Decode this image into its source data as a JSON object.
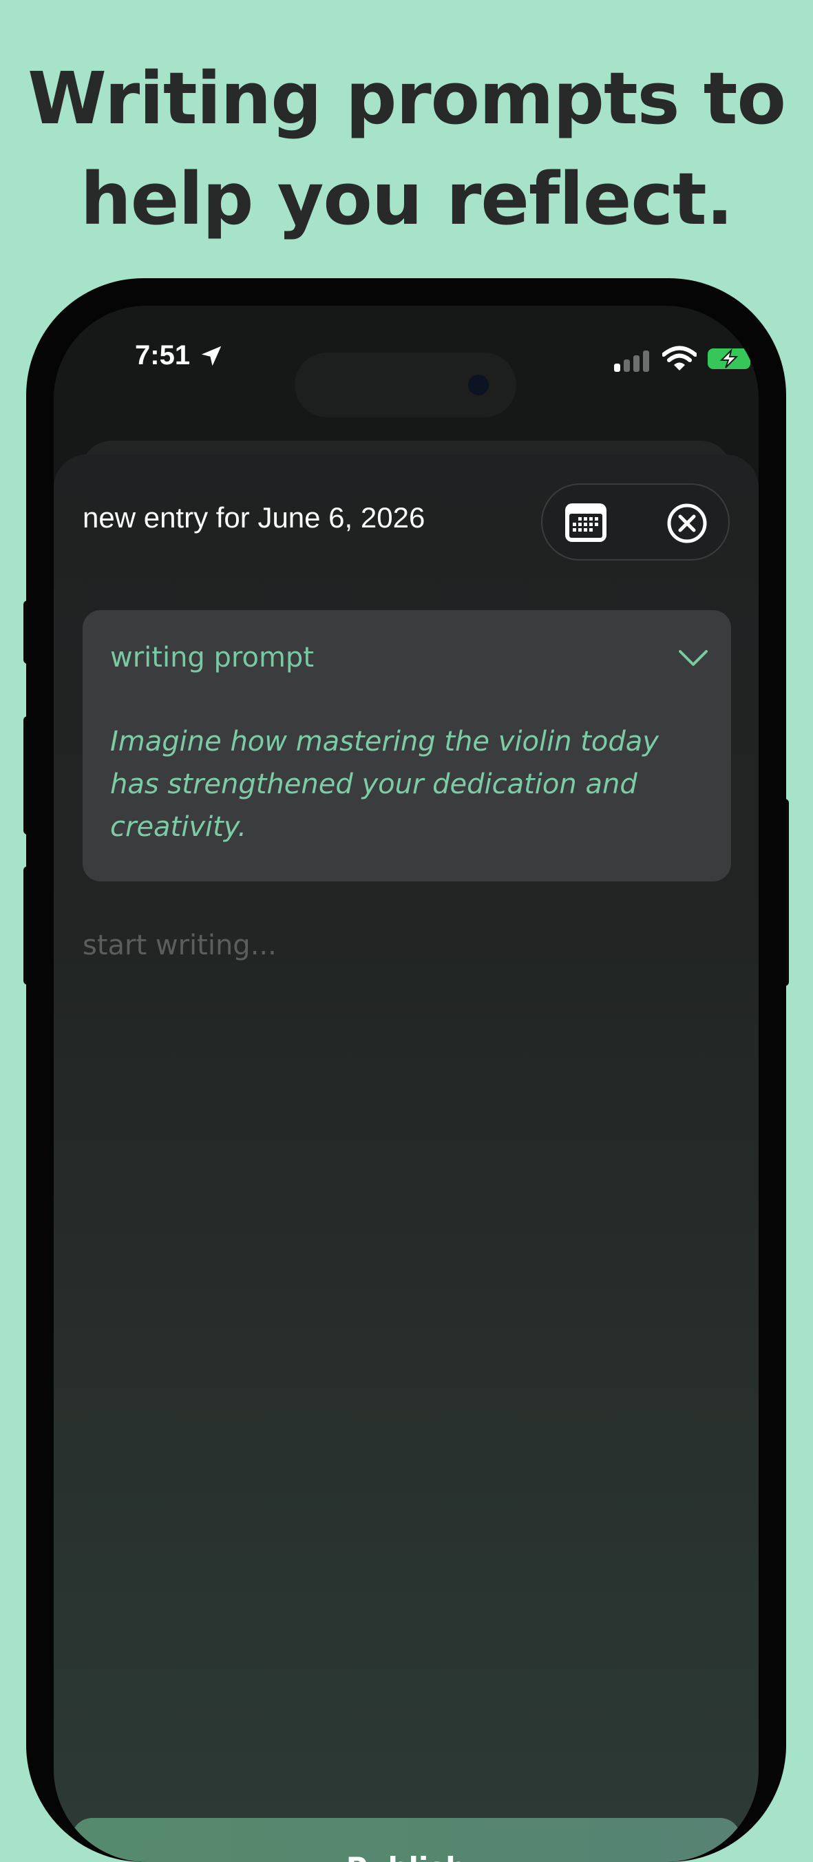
{
  "headline": {
    "line1": "Writing prompts to",
    "line2": "help you reflect."
  },
  "status_bar": {
    "time": "7:51",
    "icons": [
      "location-arrow-icon",
      "cellular-signal-icon",
      "wifi-icon",
      "battery-charging-icon"
    ],
    "battery_color": "#35c759"
  },
  "entry": {
    "title": "new entry for June 6, 2026",
    "actions": [
      "calendar-icon",
      "close-circle-icon"
    ]
  },
  "prompt": {
    "header": "writing prompt",
    "text": "Imagine how mastering the violin today has strengthened your dedication and creativity.",
    "accent_color": "#78c9a4",
    "toggle_icon": "chevron-down-icon"
  },
  "editor": {
    "placeholder": "start writing..."
  },
  "publish": {
    "label": "Publish",
    "color": "#568a6e"
  },
  "colors": {
    "background": "#a6e3c9",
    "headline": "#282a29"
  }
}
